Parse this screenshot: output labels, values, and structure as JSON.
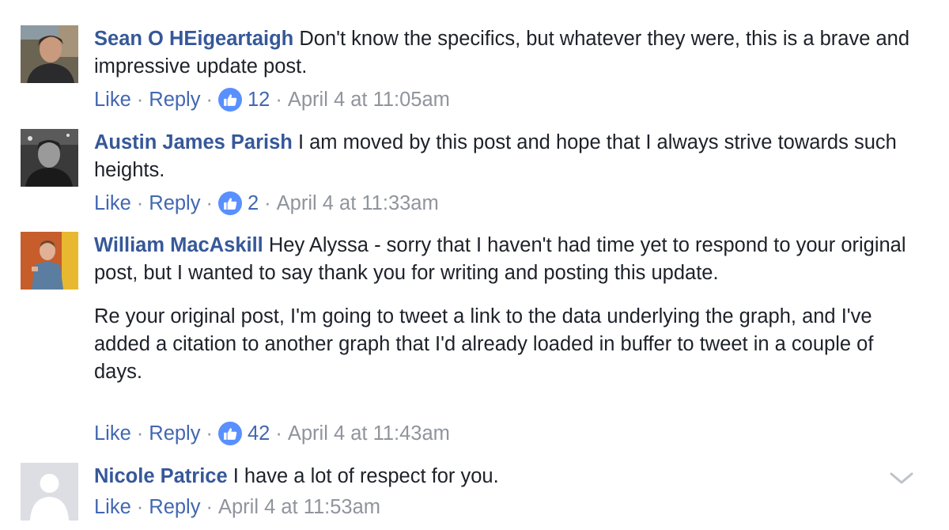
{
  "comments": [
    {
      "author": "Sean O HEigeartaigh",
      "paragraphs": [
        " Don't know the specifics, but whatever they were, this is a brave and impressive update post."
      ],
      "like_label": "Like",
      "reply_label": "Reply",
      "likes": "12",
      "timestamp": "April 4 at 11:05am"
    },
    {
      "author": "Austin James Parish",
      "paragraphs": [
        " I am moved by this post and hope that I always strive towards such heights."
      ],
      "like_label": "Like",
      "reply_label": "Reply",
      "likes": "2",
      "timestamp": "April 4 at 11:33am"
    },
    {
      "author": "William MacAskill",
      "paragraphs": [
        " Hey Alyssa - sorry that I haven't had time yet to respond to your original post, but I wanted to say thank you for writing and posting this update.",
        "Re your original post, I'm going to tweet a link to the data underlying the graph, and I've added a citation to another graph that I'd already loaded in buffer to tweet in a couple of days."
      ],
      "like_label": "Like",
      "reply_label": "Reply",
      "likes": "42",
      "timestamp": "April 4 at 11:43am"
    },
    {
      "author": "Nicole Patrice",
      "paragraphs": [
        " I have a lot of respect for you."
      ],
      "like_label": "Like",
      "reply_label": "Reply",
      "timestamp": "April 4 at 11:53am"
    }
  ],
  "separator": "·",
  "icons": {
    "like_badge": "thumbs-up-icon",
    "menu": "chevron-down-icon"
  },
  "colors": {
    "author": "#365899",
    "link": "#4267b2",
    "meta": "#90949c",
    "like_badge": "#5890ff"
  }
}
